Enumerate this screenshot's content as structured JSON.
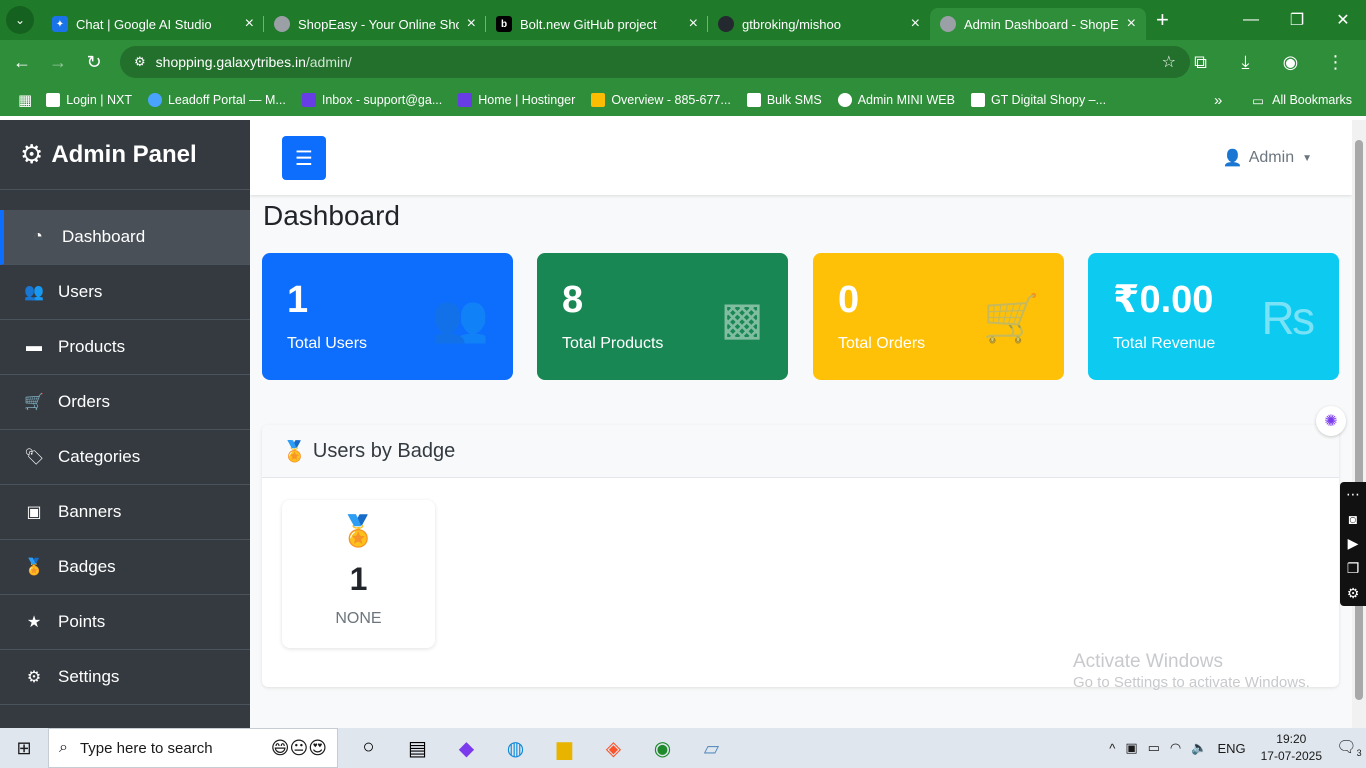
{
  "browser": {
    "tabs": [
      {
        "title": "Chat | Google AI Studio",
        "active": false,
        "fav_color": "#1a73e8"
      },
      {
        "title": "ShopEasy - Your Online Shop",
        "active": false,
        "fav_color": "#9aa0a6"
      },
      {
        "title": "Bolt.new GitHub project",
        "active": false,
        "fav_color": "#000000"
      },
      {
        "title": "gtbroking/mishoo",
        "active": false,
        "fav_color": "#24292f"
      },
      {
        "title": "Admin Dashboard - ShopEasy",
        "active": true,
        "fav_color": "#9aa0a6"
      }
    ],
    "url_host": "shopping.galaxytribes.in",
    "url_path": "/admin/",
    "bookmarks": [
      {
        "label": "Login | NXT",
        "color": "#ffffff"
      },
      {
        "label": "Leadoff Portal — M...",
        "color": "#4aa3ff"
      },
      {
        "label": "Inbox - support@ga...",
        "color": "#673de6"
      },
      {
        "label": "Home | Hostinger",
        "color": "#673de6"
      },
      {
        "label": "Overview - 885-677...",
        "color": "#fbbc04"
      },
      {
        "label": "Bulk SMS",
        "color": "#ffffff"
      },
      {
        "label": "Admin MINI WEB",
        "color": "#ffffff"
      },
      {
        "label": "GT Digital Shopy –...",
        "color": "#ffffff"
      }
    ],
    "all_bookmarks": "All Bookmarks"
  },
  "sidebar": {
    "brand": "Admin Panel",
    "items": [
      {
        "label": "Dashboard",
        "icon": "dashboard-icon",
        "glyph": "◔",
        "active": true
      },
      {
        "label": "Users",
        "icon": "users-icon",
        "glyph": "👥",
        "active": false
      },
      {
        "label": "Products",
        "icon": "box-icon",
        "glyph": "▬",
        "active": false
      },
      {
        "label": "Orders",
        "icon": "cart-icon",
        "glyph": "🛒",
        "active": false
      },
      {
        "label": "Categories",
        "icon": "tags-icon",
        "glyph": "🏷",
        "active": false
      },
      {
        "label": "Banners",
        "icon": "image-icon",
        "glyph": "▣",
        "active": false
      },
      {
        "label": "Badges",
        "icon": "medal-icon",
        "glyph": "🏅",
        "active": false
      },
      {
        "label": "Points",
        "icon": "star-icon",
        "glyph": "★",
        "active": false
      },
      {
        "label": "Settings",
        "icon": "cog-icon",
        "glyph": "⚙",
        "active": false
      }
    ]
  },
  "topnav": {
    "user": "Admin"
  },
  "page": {
    "title": "Dashboard"
  },
  "stats": [
    {
      "value": "1",
      "label": "Total Users",
      "color": "#0d6efd",
      "icon": "users-icon",
      "glyph": "👥"
    },
    {
      "value": "8",
      "label": "Total Products",
      "color": "#198754",
      "icon": "box-icon",
      "glyph": "▩"
    },
    {
      "value": "0",
      "label": "Total Orders",
      "color": "#ffc107",
      "icon": "cart-icon",
      "glyph": "🛒"
    },
    {
      "value": "₹0.00",
      "label": "Total Revenue",
      "color": "#0dcaf0",
      "icon": "rupee-icon",
      "glyph": "₨"
    }
  ],
  "badges_panel": {
    "title": "Users by Badge",
    "badges": [
      {
        "count": "1",
        "name": "NONE"
      }
    ]
  },
  "watermark": {
    "line1": "Activate Windows",
    "line2": "Go to Settings to activate Windows."
  },
  "taskbar": {
    "search_placeholder": "Type here to search",
    "lang": "ENG",
    "time": "19:20",
    "date": "17-07-2025",
    "notifications": "3"
  }
}
